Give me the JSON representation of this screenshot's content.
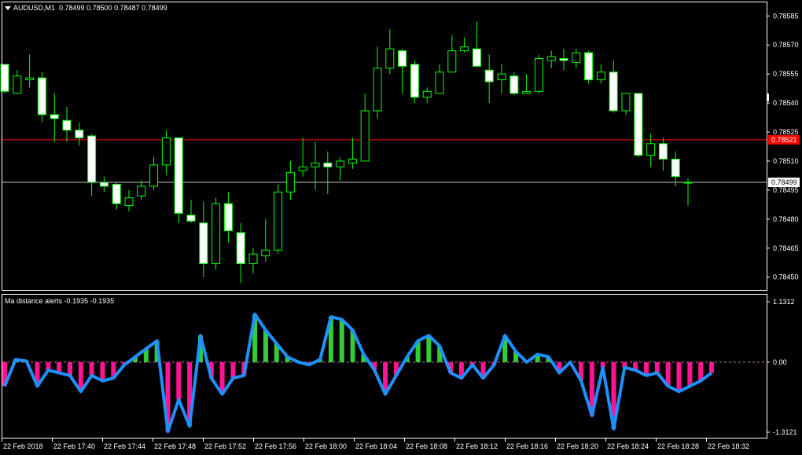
{
  "main_header": {
    "symbol": "AUDUSD,M1",
    "ohlc": "0.78499 0.78500 0.78487 0.78499"
  },
  "indicator_header": {
    "name": "Ma distance alerts",
    "values": "-0.1935 -0.1935"
  },
  "colors": {
    "background": "#000000",
    "grid_frame": "#ffffff",
    "bull_body": "#000000",
    "bear_body": "#ffffff",
    "wick": "#00ff00",
    "ask_line": "#ff0000",
    "bid_line": "#c0c0c0",
    "hist_up": "#32cd32",
    "hist_down": "#ff1493",
    "ma_line": "#1e90ff"
  },
  "price_axis": {
    "ticks": [
      "0.78585",
      "0.78570",
      "0.78555",
      "0.78540",
      "0.78525",
      "0.78510",
      "0.78495",
      "0.78480",
      "0.78465",
      "0.78450"
    ],
    "ask_label": "0.78521",
    "bid_label": "0.78499"
  },
  "indicator_axis": {
    "ticks": [
      "1.1312",
      "0.00",
      "-1.3121"
    ]
  },
  "time_axis": {
    "ticks": [
      "22 Feb 2018",
      "22 Feb 17:40",
      "22 Feb 17:44",
      "22 Feb 17:48",
      "22 Feb 17:52",
      "22 Feb 17:56",
      "22 Feb 18:00",
      "22 Feb 18:04",
      "22 Feb 18:08",
      "22 Feb 18:12",
      "22 Feb 18:16",
      "22 Feb 18:20",
      "22 Feb 18:24",
      "22 Feb 18:28",
      "22 Feb 18:32"
    ]
  },
  "chart_data": {
    "type": "candlestick",
    "price_range": [
      0.78445,
      0.7859
    ],
    "ask_price": 0.78521,
    "bid_price": 0.78499,
    "candles": [
      [
        0.7856,
        0.7856,
        0.78545,
        0.78546
      ],
      [
        0.78545,
        0.78557,
        0.78545,
        0.78554
      ],
      [
        0.78552,
        0.78565,
        0.78548,
        0.78553
      ],
      [
        0.78553,
        0.78556,
        0.7853,
        0.78534
      ],
      [
        0.78534,
        0.78545,
        0.7852,
        0.78532
      ],
      [
        0.78531,
        0.78538,
        0.7852,
        0.78526
      ],
      [
        0.78526,
        0.7853,
        0.78518,
        0.78522
      ],
      [
        0.78523,
        0.78524,
        0.78492,
        0.78499
      ],
      [
        0.78499,
        0.78502,
        0.78494,
        0.78497
      ],
      [
        0.78498,
        0.78499,
        0.78485,
        0.78488
      ],
      [
        0.78487,
        0.78495,
        0.78484,
        0.78491
      ],
      [
        0.78492,
        0.785,
        0.7849,
        0.78497
      ],
      [
        0.78497,
        0.78512,
        0.78495,
        0.78508
      ],
      [
        0.78508,
        0.78526,
        0.78503,
        0.78522
      ],
      [
        0.78522,
        0.78522,
        0.78478,
        0.78483
      ],
      [
        0.78482,
        0.7849,
        0.78478,
        0.78479
      ],
      [
        0.78478,
        0.78489,
        0.7845,
        0.78457
      ],
      [
        0.78457,
        0.78491,
        0.78454,
        0.78488
      ],
      [
        0.78488,
        0.78494,
        0.78468,
        0.78474
      ],
      [
        0.78473,
        0.78478,
        0.78447,
        0.78457
      ],
      [
        0.78457,
        0.78465,
        0.78452,
        0.78462
      ],
      [
        0.78461,
        0.7848,
        0.78458,
        0.78464
      ],
      [
        0.78464,
        0.78498,
        0.78462,
        0.78494
      ],
      [
        0.78494,
        0.7851,
        0.7849,
        0.78504
      ],
      [
        0.78505,
        0.78522,
        0.78502,
        0.78507
      ],
      [
        0.78507,
        0.7852,
        0.78495,
        0.78509
      ],
      [
        0.78509,
        0.78515,
        0.78493,
        0.78507
      ],
      [
        0.78507,
        0.78512,
        0.785,
        0.7851
      ],
      [
        0.78509,
        0.78522,
        0.78506,
        0.78511
      ],
      [
        0.7851,
        0.78545,
        0.7851,
        0.78536
      ],
      [
        0.78536,
        0.78569,
        0.78532,
        0.78558
      ],
      [
        0.78558,
        0.78578,
        0.78555,
        0.78568
      ],
      [
        0.78567,
        0.78568,
        0.78545,
        0.78559
      ],
      [
        0.7856,
        0.78562,
        0.7854,
        0.78543
      ],
      [
        0.78543,
        0.78548,
        0.7854,
        0.78546
      ],
      [
        0.78545,
        0.7856,
        0.78545,
        0.78556
      ],
      [
        0.78556,
        0.78575,
        0.78556,
        0.78567
      ],
      [
        0.78567,
        0.78574,
        0.78566,
        0.78569
      ],
      [
        0.78568,
        0.78582,
        0.7856,
        0.78559
      ],
      [
        0.78557,
        0.78565,
        0.7854,
        0.78551
      ],
      [
        0.78552,
        0.7856,
        0.78545,
        0.78555
      ],
      [
        0.78554,
        0.78556,
        0.78544,
        0.78545
      ],
      [
        0.78545,
        0.78555,
        0.78545,
        0.78546
      ],
      [
        0.78546,
        0.78565,
        0.78545,
        0.78563
      ],
      [
        0.78562,
        0.78567,
        0.78558,
        0.78564
      ],
      [
        0.78563,
        0.78568,
        0.78557,
        0.78562
      ],
      [
        0.78561,
        0.78568,
        0.78558,
        0.78566
      ],
      [
        0.78566,
        0.78567,
        0.7855,
        0.78552
      ],
      [
        0.78552,
        0.7856,
        0.7855,
        0.78556
      ],
      [
        0.78556,
        0.78562,
        0.78535,
        0.78536
      ],
      [
        0.78536,
        0.78545,
        0.78534,
        0.78545
      ],
      [
        0.78545,
        0.78545,
        0.78512,
        0.78513
      ],
      [
        0.78513,
        0.78524,
        0.78507,
        0.78519
      ],
      [
        0.78519,
        0.78522,
        0.78505,
        0.78511
      ],
      [
        0.78511,
        0.78515,
        0.78497,
        0.78502
      ],
      [
        0.78499,
        0.78501,
        0.78487,
        0.78499
      ]
    ],
    "indicator_range": [
      -1.3121,
      1.1312
    ],
    "indicator": [
      -0.45,
      0.05,
      0.02,
      -0.45,
      -0.15,
      -0.2,
      -0.25,
      -0.55,
      -0.25,
      -0.35,
      -0.3,
      -0.05,
      0.1,
      0.25,
      0.4,
      -1.3,
      -0.7,
      -1.2,
      0.5,
      -0.3,
      -0.6,
      -0.3,
      -0.25,
      0.9,
      0.6,
      0.35,
      0.1,
      0.0,
      -0.05,
      0.05,
      0.85,
      0.8,
      0.6,
      0.15,
      -0.15,
      -0.6,
      -0.25,
      0.1,
      0.4,
      0.5,
      0.3,
      -0.2,
      -0.3,
      -0.05,
      -0.3,
      -0.05,
      0.5,
      0.2,
      0.0,
      0.15,
      0.1,
      -0.2,
      0.0,
      -0.35,
      -1.0,
      -0.1,
      -1.25,
      -0.1,
      -0.15,
      -0.25,
      -0.2,
      -0.45,
      -0.55,
      -0.45,
      -0.35,
      -0.2
    ]
  }
}
